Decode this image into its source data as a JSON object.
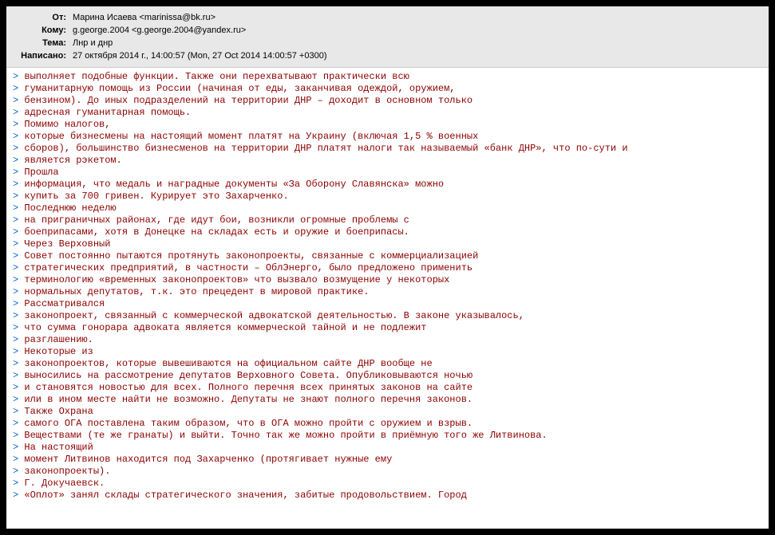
{
  "header": {
    "from_label": "От:",
    "from_value": "Марина Исаева <marinissa@bk.ru>",
    "to_label": "Кому:",
    "to_value": "g.george.2004 <g.george.2004@yandex.ru>",
    "subject_label": "Тема:",
    "subject_value": "Лнр и днр",
    "date_label": "Написано:",
    "date_value": "27 октября 2014 г., 14:00:57  (Mon, 27 Oct 2014 14:00:57 +0300)"
  },
  "body_lines": [
    "выполняет подобные функции. Также они перехватывают практически всю",
    "гуманитарную помощь из России (начиная от еды, заканчивая одеждой, оружием,",
    "бензином). До иных подразделений на территории ДНР – доходит в основном только",
    "адресная гуманитарная помощь.",
    "Помимо налогов,",
    "которые бизнесмены на настоящий момент платят на Украину (включая 1,5 % военных",
    "сборов), большинство бизнесменов на территории ДНР платят налоги   так называемый «банк ДНР», что по-сути и",
    "является рэкетом.",
    "Прошла",
    "информация, что медаль и наградные документы «За Оборону Славянска» можно",
    "купить за 700 гривен. Курирует это Захарченко.",
    "Последнюю неделю",
    "на приграничных районах, где идут бои, возникли огромные проблемы с",
    "боеприпасами, хотя в Донецке на складах есть и оружие и боеприпасы.",
    "Через Верховный",
    "Совет постоянно пытаются протянуть законопроекты, связанные с коммерциализацией",
    "стратегических предприятий, в частности – ОблЭнерго, было предложено применить",
    "терминологию «временных законопроектов» что вызвало возмущение у некоторых",
    "нормальных депутатов, т.к. это прецедент в мировой практике.",
    "Рассматривался",
    "законопроект, связанный с коммерческой адвокатской деятельностью. В законе указывалось,",
    "что сумма гонорара адвоката является коммерческой тайной и не подлежит",
    "разглашению.",
    "Некоторые из",
    "законопроектов, которые вывешиваются на официальном сайте ДНР вообще не",
    "выносились на рассмотрение депутатов Верховного Совета. Опубликовываются ночью",
    "и становятся новостью для всех. Полного перечня всех принятых законов на сайте",
    "или в ином месте найти не возможно. Депутаты не знают полного перечня законов.",
    "Также Охрана",
    "самого ОГА поставлена таким образом, что в ОГА можно пройти с оружием и взрыв.",
    "Веществами (те же гранаты) и выйти.   Точно так же можно пройти в приёмную   того же Литвинова.",
    "На настоящий",
    "момент Литвинов находится под Захарченко (протягивает нужные ему",
    "законопроекты).",
    "Г. Докучаевск.",
    "«Оплот» занял склады стратегического значения, забитые продовольствием. Город"
  ]
}
